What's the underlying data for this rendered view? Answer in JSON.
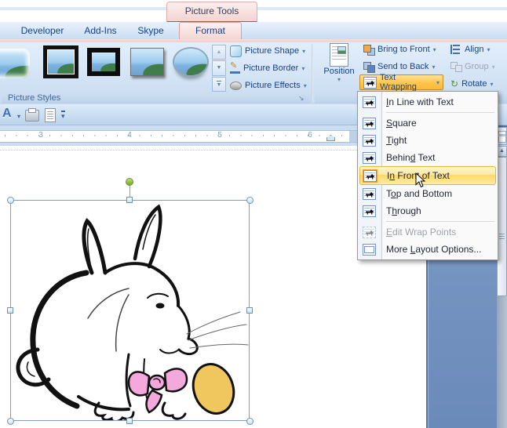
{
  "contextual_header": {
    "label": "Picture Tools"
  },
  "tabs": [
    {
      "label": "Developer"
    },
    {
      "label": "Add-Ins"
    },
    {
      "label": "Skype"
    },
    {
      "label": "Format",
      "active": true
    }
  ],
  "ribbon": {
    "picture_styles": {
      "group_label": "Picture Styles",
      "gallery_styles": [
        "soft-edge-rectangle",
        "metal-frame",
        "simple-frame-black",
        "simple-frame-white",
        "beveled-oval"
      ],
      "buttons": [
        {
          "label": "Picture Shape"
        },
        {
          "label": "Picture Border"
        },
        {
          "label": "Picture Effects"
        }
      ]
    },
    "arrange": {
      "position_label": "Position",
      "buttons": [
        {
          "label": "Bring to Front"
        },
        {
          "label": "Send to Back"
        },
        {
          "label": "Text Wrapping",
          "highlighted": true
        }
      ],
      "right_buttons": [
        {
          "label": "Align"
        },
        {
          "label": "Group",
          "disabled": true
        },
        {
          "label": "Rotate"
        }
      ]
    }
  },
  "menu": {
    "items": [
      {
        "pre": "",
        "key": "I",
        "post": "n Line with Text",
        "label": "In Line with Text"
      },
      {
        "pre": "",
        "key": "S",
        "post": "quare",
        "label": "Square"
      },
      {
        "pre": "",
        "key": "T",
        "post": "ight",
        "label": "Tight"
      },
      {
        "pre": "Behin",
        "key": "d",
        "post": " Text",
        "label": "Behind Text"
      },
      {
        "pre": "I",
        "key": "n",
        "post": " Front of Text",
        "label": "In Front of Text",
        "highlighted": true
      },
      {
        "pre": "T",
        "key": "o",
        "post": "p and Bottom",
        "label": "Top and Bottom"
      },
      {
        "pre": "T",
        "key": "h",
        "post": "rough",
        "label": "Through"
      },
      {
        "pre": "",
        "key": "E",
        "post": "dit Wrap Points",
        "label": "Edit Wrap Points",
        "disabled": true
      },
      {
        "pre": "More ",
        "key": "L",
        "post": "ayout Options...",
        "label": "More Layout Options..."
      }
    ]
  },
  "ruler": {
    "numbers": [
      "3",
      "4",
      "5",
      "6"
    ]
  },
  "icons": {
    "dropdown_arrow": "▾",
    "scroll_up_arrow": "▲",
    "scroll_down_arrow": "▼",
    "gallery_more_arrow": "▼",
    "toolbar_overflow_arrow": "▾",
    "dialog_launcher": "↘",
    "font_styles_letter": "A",
    "pencil_glyph": "✎",
    "rotate_glyph": "↻"
  },
  "canvas": {
    "clipart": "bunny-with-pink-bow-and-golden-egg",
    "colors": {
      "bow_pink": "#f3a9db",
      "egg_gold": "#efc75e",
      "line_art": "#111111",
      "selection_green_handle": "#8cc540",
      "highlight_orange": "#ffc549"
    }
  }
}
